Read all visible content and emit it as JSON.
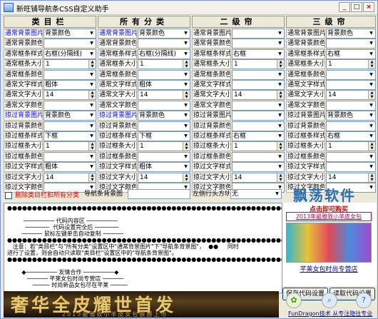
{
  "window": {
    "title": "新旺铺导航条CSS自定义助手",
    "min": "_",
    "max": "□",
    "close": "×"
  },
  "headers": {
    "col1": "类目栏",
    "col2": "所有分类",
    "col3": "二级帘",
    "col4": "三级帘"
  },
  "col1": {
    "labels": [
      "通常背景图片",
      "通常背景颜色",
      "通常框条样式",
      "通常框条大小",
      "通常框条颜色",
      "通常文字样式",
      "通常文字大小",
      "通常文字颜色",
      "掠过背景图片",
      "掠过背景颜色",
      "掠过框条样式",
      "掠过框条大小",
      "掠过框条颜色",
      "掠过文字样式",
      "掠过文字大小",
      "掠过文字颜色"
    ],
    "values": [
      {
        "type": "select",
        "v": "背景颜色"
      },
      {
        "type": "select",
        "v": ""
      },
      {
        "type": "select",
        "v": "右框(分隔线)"
      },
      {
        "type": "spin",
        "v": "1"
      },
      {
        "type": "select",
        "v": ""
      },
      {
        "type": "select",
        "v": "粗体"
      },
      {
        "type": "spin",
        "v": "14"
      },
      {
        "type": "select",
        "v": ""
      },
      {
        "type": "select",
        "v": "背景颜色"
      },
      {
        "type": "select",
        "v": ""
      },
      {
        "type": "select",
        "v": "下框"
      },
      {
        "type": "spin",
        "v": "1"
      },
      {
        "type": "select",
        "v": ""
      },
      {
        "type": "select",
        "v": "粗体"
      },
      {
        "type": "spin",
        "v": "14"
      },
      {
        "type": "select",
        "v": ""
      }
    ]
  },
  "col2": {
    "labels": [
      "通常背景图片",
      "通常背景颜色",
      "通常框条样式",
      "通常框条大小",
      "通常框条颜色",
      "通常文字样式",
      "通常文字大小",
      "通常文字颜色",
      "掠过背景图片",
      "掠过背景颜色",
      "掠过框条样式",
      "掠过框条大小",
      "掠过框条颜色",
      "掠过文字样式",
      "掠过文字大小",
      "掠过文字颜色"
    ],
    "values": [
      {
        "type": "select",
        "v": "背景颜色"
      },
      {
        "type": "select",
        "v": ""
      },
      {
        "type": "select",
        "v": "右框(分隔线)"
      },
      {
        "type": "spin",
        "v": "1"
      },
      {
        "type": "select",
        "v": ""
      },
      {
        "type": "select",
        "v": "粗体"
      },
      {
        "type": "spin",
        "v": "14"
      },
      {
        "type": "select",
        "v": ""
      },
      {
        "type": "select",
        "v": "背景颜色"
      },
      {
        "type": "select",
        "v": ""
      },
      {
        "type": "select",
        "v": "下框"
      },
      {
        "type": "spin",
        "v": "1"
      },
      {
        "type": "select",
        "v": ""
      },
      {
        "type": "select",
        "v": "粗体"
      },
      {
        "type": "spin",
        "v": "14"
      },
      {
        "type": "select",
        "v": ""
      }
    ]
  },
  "col3": {
    "labels": [
      "通常背景图片",
      "通常背景颜色",
      "通常框条样式",
      "通常框条大小",
      "通常框条颜色",
      "通常文字样式",
      "通常文字大小",
      "通常文字颜色",
      "掠过背景图片",
      "掠过背景颜色",
      "掠过框条样式",
      "掠过框条大小",
      "掠过框条颜色",
      "掠过文字样式",
      "掠过文字大小",
      "掠过文字颜色"
    ],
    "values": [
      {
        "type": "select",
        "v": ""
      },
      {
        "type": "select",
        "v": ""
      },
      {
        "type": "select",
        "v": "右框"
      },
      {
        "type": "spin",
        "v": "1"
      },
      {
        "type": "select",
        "v": ""
      },
      {
        "type": "select",
        "v": ""
      },
      {
        "type": "spin",
        "v": "14"
      },
      {
        "type": "select",
        "v": ""
      },
      {
        "type": "select",
        "v": ""
      },
      {
        "type": "select",
        "v": ""
      },
      {
        "type": "select",
        "v": "右框"
      },
      {
        "type": "spin",
        "v": "1"
      },
      {
        "type": "select",
        "v": ""
      },
      {
        "type": "select",
        "v": ""
      },
      {
        "type": "spin",
        "v": "14"
      },
      {
        "type": "select",
        "v": ""
      }
    ]
  },
  "col4": {
    "labels": [
      "通常背景图片",
      "通常背景颜色",
      "通常框条样式",
      "通常框条大小",
      "通常框条颜色",
      "通常文字样式",
      "通常文字大小",
      "通常文字颜色",
      "掠过背景图片",
      "掠过背景颜色",
      "掠过框条样式",
      "掠过框条大小",
      "掠过框条颜色",
      "掠过文字样式",
      "掠过文字大小",
      "掠过文字颜色"
    ],
    "values": [
      {
        "type": "select",
        "v": "背景颜色"
      },
      {
        "type": "select",
        "v": ""
      },
      {
        "type": "select",
        "v": "右框"
      },
      {
        "type": "spin",
        "v": "1"
      },
      {
        "type": "select",
        "v": ""
      },
      {
        "type": "select",
        "v": ""
      },
      {
        "type": "spin",
        "v": "14"
      },
      {
        "type": "select",
        "v": ""
      },
      {
        "type": "select",
        "v": "背景颜色"
      },
      {
        "type": "select",
        "v": ""
      },
      {
        "type": "select",
        "v": "右框"
      },
      {
        "type": "spin",
        "v": "1"
      },
      {
        "type": "select",
        "v": ""
      },
      {
        "type": "select",
        "v": ""
      },
      {
        "type": "spin",
        "v": "14"
      },
      {
        "type": "select",
        "v": ""
      }
    ]
  },
  "controls": {
    "delete_checkbox_label": "删除类目栏和所有分类",
    "nav_bg_label": "导航条背景图",
    "nav_bg_value": "",
    "left_inline_label": "左侧行头方块",
    "left_inline_value": "无"
  },
  "code_lines": [
    "●●●●●●●●●●●●●●●●●●●●●●●●●●●●●●●●●●●●●●●●●●●●●●●●●●●●●●●●●●●",
    "",
    "         ───────── 代码内容区 ─────────",
    "          ───────  代码设置完全后 ───────",
    "        ────── 鼠标左键单击自动复制 ──────",
    "●●●●●●●●●●●●●●●●●●●●●●●●●●●●●●●●●●●●●●●●●●●●●●●●●●●●●●●●●●●",
    "   注意：若\"类目栏\"与\"所有分类\"设置区中\"通常背景图片\"下\"导航条背景图\"，  ●●     同时",
    "进行了设置，则会自动只读取\"类目栏\"设置区中的\"导航条背景图\"。",
    "●●●●●●●●●●●●●●●●●●●●●●●●●●●●●●●●●●●●●●●●●●●●●●●●●●●●●●●●●●●",
    "",
    "        ◆───────── 友情合作 ─────────◆",
    "           ────── 芊莱女包时尚专营店 ──────",
    "              ───── 时尚新品女包尽在芊莱 ─────"
  ],
  "right_panel": {
    "logo": "飘荡软件",
    "ad_top": "2013年最雅致小羊皮女包",
    "ad_headline": "点击即可购买",
    "ad_caption": "芊莱女包时尚专营店",
    "save_btn": "保存代码设置",
    "read_btn": "读取代码设置"
  },
  "banner": {
    "main": "奢华全皮耀世首发",
    "sub": "2013最雅致小羊皮女包震撼上市"
  },
  "footer": {
    "credit": "FunDragon技术 从专注隐往专业"
  }
}
